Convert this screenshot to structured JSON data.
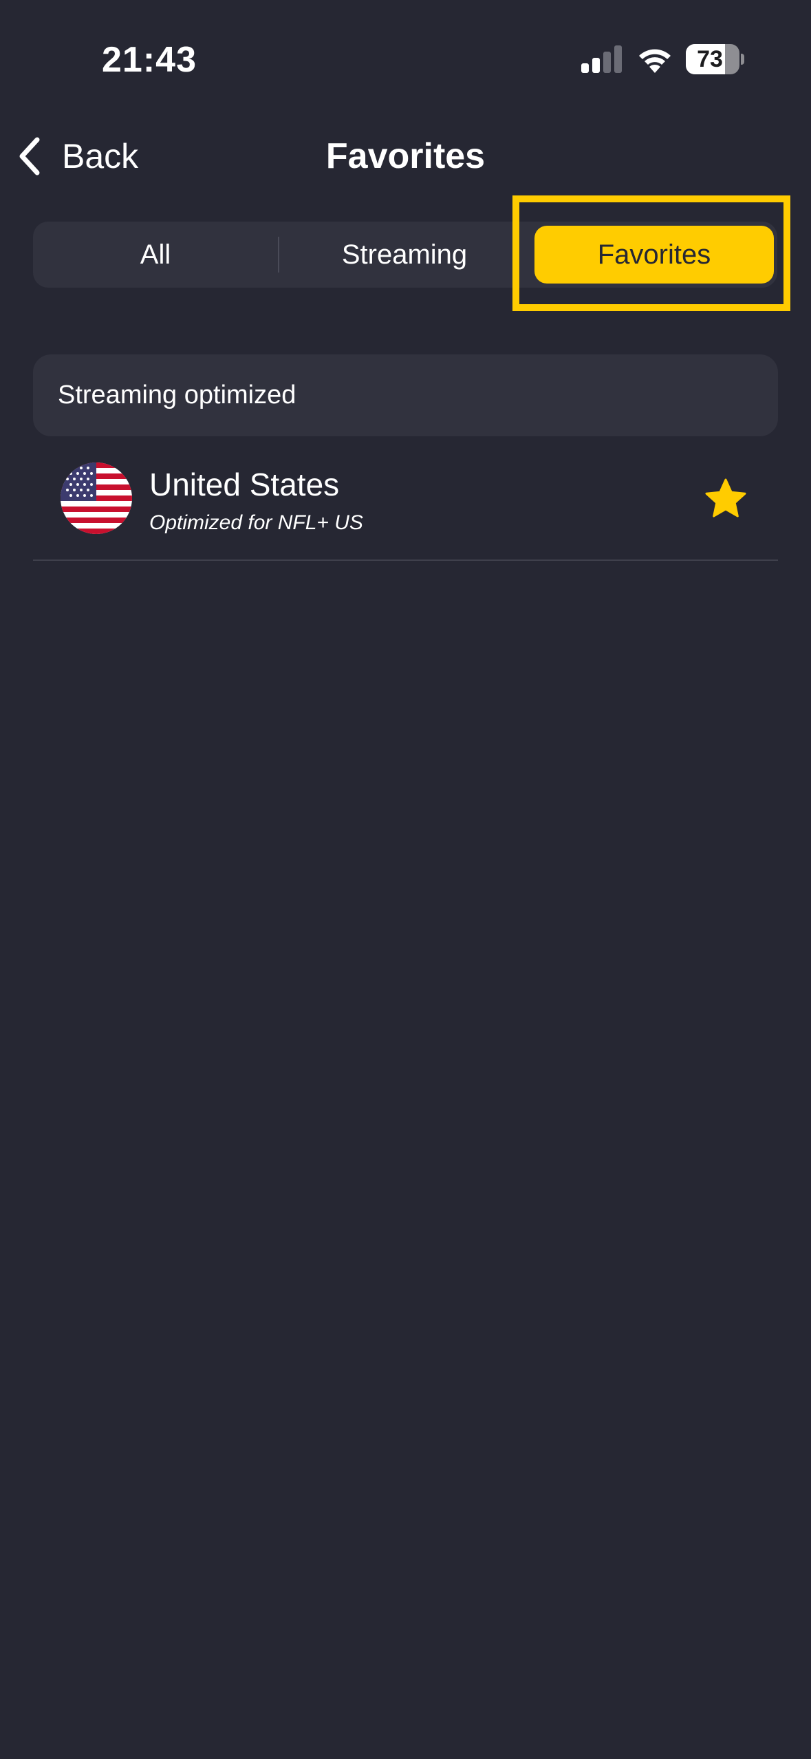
{
  "status_bar": {
    "time": "21:43",
    "battery_percent": "73",
    "battery_level": 0.73,
    "signal_bars_active": 2,
    "signal_bars_total": 4
  },
  "nav": {
    "back_label": "Back",
    "title": "Favorites"
  },
  "tabs": {
    "items": [
      "All",
      "Streaming",
      "Favorites"
    ],
    "selected": "Favorites"
  },
  "section": {
    "label": "Streaming optimized"
  },
  "list": [
    {
      "title": "United States",
      "subtitle": "Optimized for NFL+ US",
      "flag_icon": "us-flag-icon",
      "favorite": true
    }
  ],
  "colors": {
    "background": "#262733",
    "surface": "#31323e",
    "accent": "#ffcc00",
    "text": "#ffffff"
  },
  "icons": {
    "back": "chevron-left-icon",
    "favorite": "star-icon",
    "signal": "signal-icon",
    "wifi": "wifi-icon",
    "battery": "battery-icon"
  }
}
